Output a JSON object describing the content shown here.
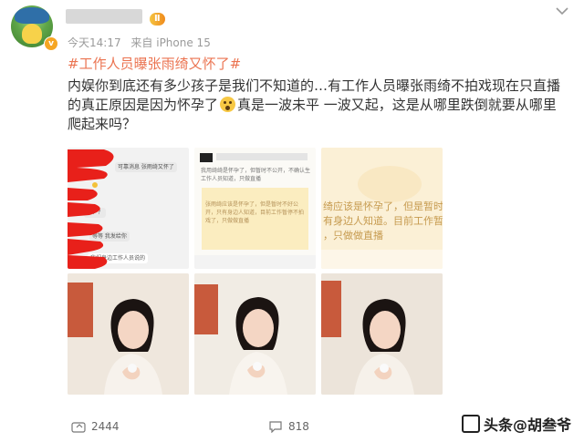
{
  "post": {
    "level_badge": "Ⅱ",
    "time": "今天14:17",
    "source": "来自 iPhone 15",
    "hashtag": "#工作人员曝张雨绮又怀了#",
    "text_part1": "内娱你到底还有多少孩子是我们不知道的…有工作人员曝张雨绮不拍戏现在只直播的真正原因是因为怀孕了",
    "text_part2": "真是一波未平 一波又起，这是从哪里跌倒就要从哪里爬起来吗？"
  },
  "image1": {
    "lines": [
      "可靠消息 张雨绮又怀了",
      "？？？",
      "等等 我发给你",
      "我们身边工作人员说的"
    ]
  },
  "image2": {
    "top_line": "我用绮绮是怀孕了，但暂时不公开，不确认生工作人员知道，只做直播",
    "note_lines": [
      "张雨绮应该是怀孕了，但是暂时不好公开，只有身边人知道，目前工作暂停不拍戏了，只做做直播"
    ]
  },
  "image3": {
    "note_lines": [
      "绮应该是怀孕了，但是暂时不",
      "有身边人知道。目前工作暂",
      "，只做做直播"
    ]
  },
  "footer": {
    "shares": "2444",
    "comments": "818",
    "watermark": "头条@胡叁爷"
  },
  "colors": {
    "link": "#eb7350",
    "meta": "#9a9a9a"
  }
}
